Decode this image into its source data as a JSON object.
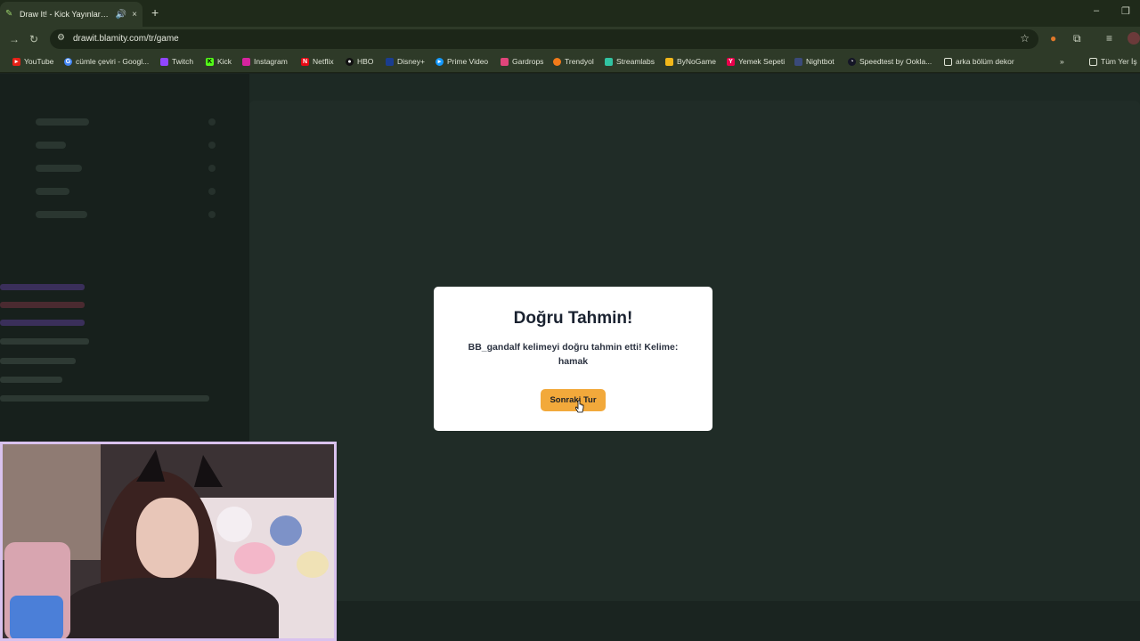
{
  "tab": {
    "title": "Draw It! - Kick Yayınları İçin",
    "close": "×",
    "new_tab": "+"
  },
  "window_controls": {
    "minimize": "–",
    "restore": "❐"
  },
  "address": {
    "url": "drawit.blamity.com/tr/game"
  },
  "bookmarks": [
    {
      "label": "YouTube",
      "color": "#e62117"
    },
    {
      "label": "cümle çeviri - Googl...",
      "color": "#4285f4"
    },
    {
      "label": "Twitch",
      "color": "#9146ff"
    },
    {
      "label": "Kick",
      "color": "#53fc18"
    },
    {
      "label": "Instagram",
      "color": "#d6249f"
    },
    {
      "label": "Netflix",
      "color": "#e50914"
    },
    {
      "label": "HBO",
      "color": "#111111"
    },
    {
      "label": "Disney+",
      "color": "#1a3d8f"
    },
    {
      "label": "Prime Video",
      "color": "#1399ff"
    },
    {
      "label": "Gardrops",
      "color": "#e0457b"
    },
    {
      "label": "Trendyol",
      "color": "#f27a1a"
    },
    {
      "label": "Streamlabs",
      "color": "#31c3a2"
    },
    {
      "label": "ByNoGame",
      "color": "#f2b71a"
    },
    {
      "label": "Yemek Sepeti",
      "color": "#ea004b"
    },
    {
      "label": "Nightbot",
      "color": "#3a4a7a"
    },
    {
      "label": "Speedtest by Ookla...",
      "color": "#141526"
    },
    {
      "label": "arka bölüm dekor",
      "color": "#2e3a28"
    }
  ],
  "bookmarks_overflow": "»",
  "all_bookmarks": "Tüm Yer İş",
  "modal": {
    "title": "Doğru Tahmin!",
    "message": "BB_gandalf kelimeyi doğru tahmin etti! Kelime: hamak",
    "button": "Sonraki Tur",
    "button_color": "#f2a93b"
  }
}
